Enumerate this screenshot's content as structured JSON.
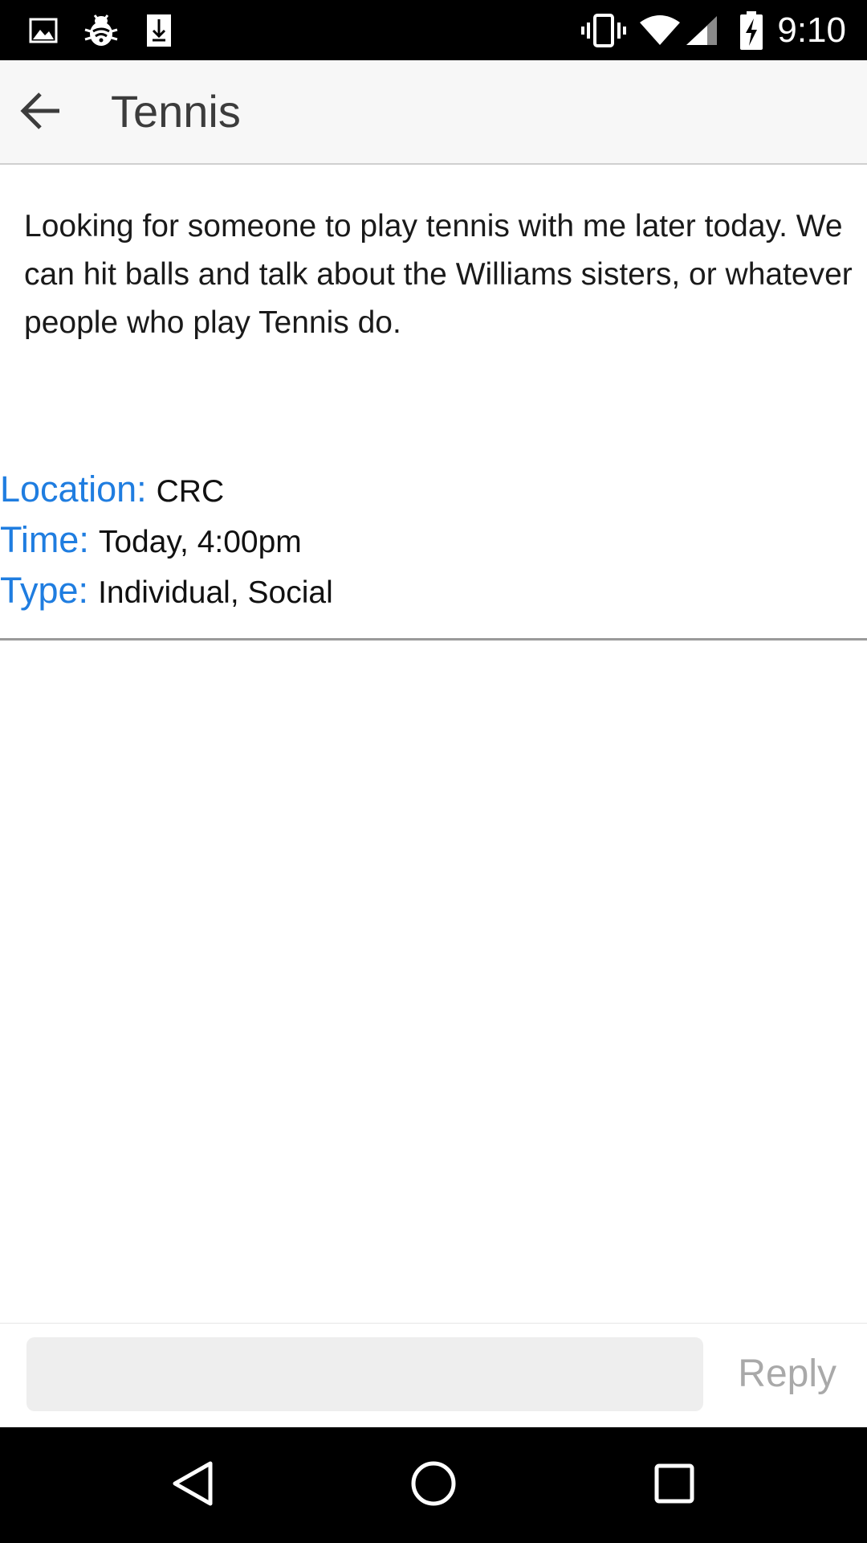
{
  "status_bar": {
    "time": "9:10",
    "left_icons": [
      "image-icon",
      "bug-icon",
      "download-icon"
    ],
    "right_icons": [
      "vibrate-icon",
      "wifi-icon",
      "signal-icon",
      "battery-charging-icon"
    ]
  },
  "app_bar": {
    "title": "Tennis",
    "back_icon": "arrow-back-icon"
  },
  "post": {
    "body": "Looking for someone to play tennis with me later today. We can hit balls and talk about the Williams sisters, or whatever people who play Tennis do.",
    "details": [
      {
        "label": "Location:",
        "value": "CRC"
      },
      {
        "label": "Time:",
        "value": "Today, 4:00pm"
      },
      {
        "label": "Type:",
        "value": "Individual, Social"
      }
    ]
  },
  "reply": {
    "input_value": "",
    "input_placeholder": "",
    "button_label": "Reply"
  },
  "nav_bar": {
    "buttons": [
      "back-triangle-icon",
      "home-circle-icon",
      "recents-square-icon"
    ]
  },
  "colors": {
    "accent": "#1f7de0",
    "status_bar": "#000000",
    "app_bar": "#f7f7f7",
    "reply_disabled": "#a9a9a9"
  }
}
